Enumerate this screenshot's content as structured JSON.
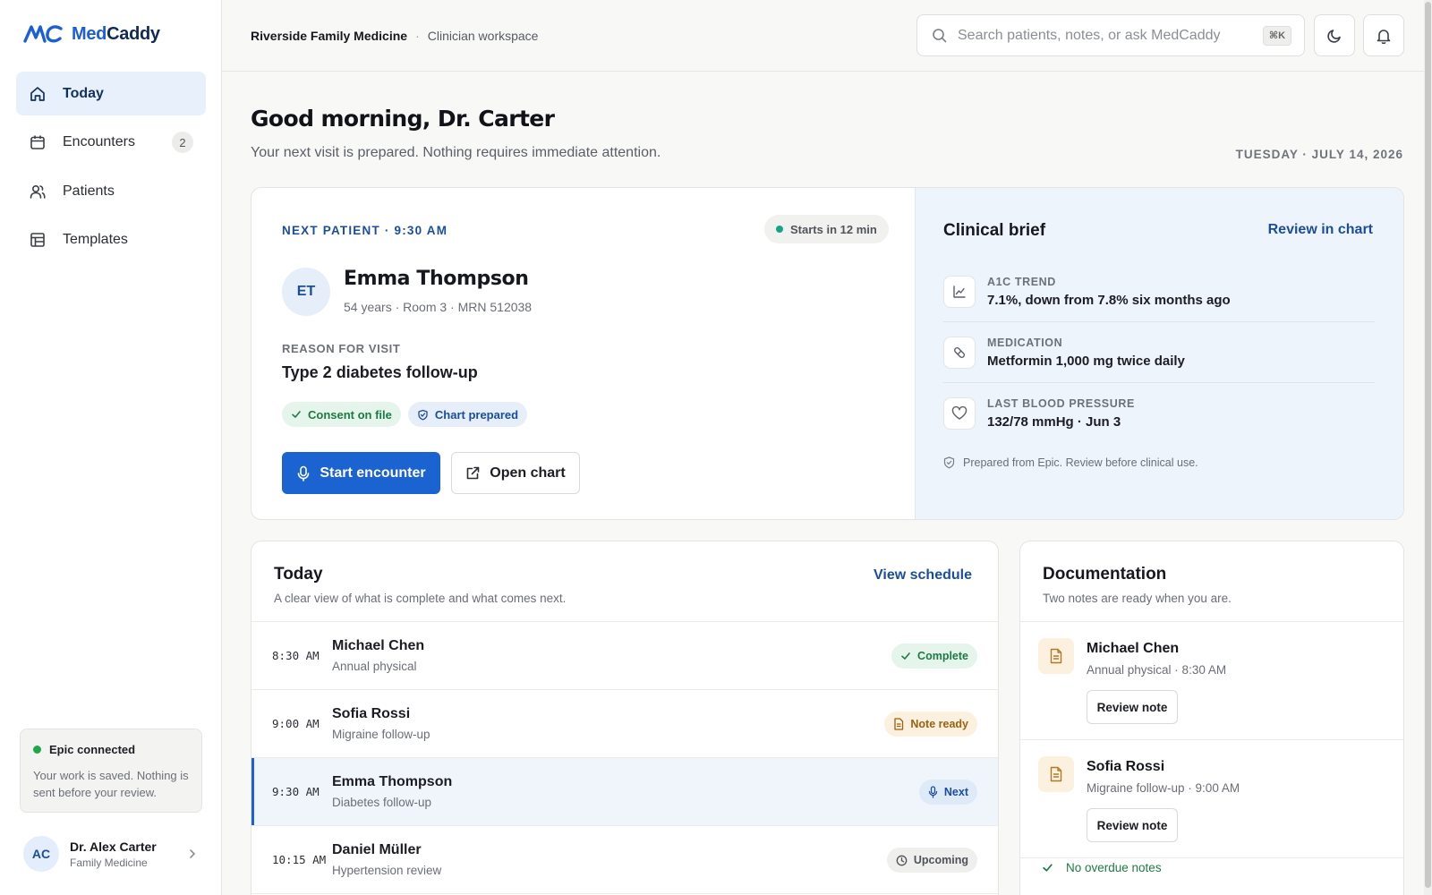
{
  "app": {
    "logo_monogram": "MC",
    "logo_part1": "Med",
    "logo_part2": "Caddy",
    "brand_color": "#1b5fd6"
  },
  "sidebar": {
    "items": [
      {
        "label": "Today",
        "icon": "home-icon",
        "active": true
      },
      {
        "label": "Encounters",
        "icon": "calendar-icon",
        "badge": "2"
      },
      {
        "label": "Patients",
        "icon": "users-icon"
      },
      {
        "label": "Templates",
        "icon": "template-icon"
      }
    ],
    "status": {
      "title": "Epic connected",
      "text": "Your work is saved. Nothing is sent before your review."
    },
    "user": {
      "initials": "AC",
      "name": "Dr. Alex Carter",
      "role": "Family Medicine"
    }
  },
  "header": {
    "clinic": "Riverside Family Medicine",
    "separator": "·",
    "workspace": "Clinician workspace",
    "search_placeholder": "Search patients, notes, or ask MedCaddy",
    "search_shortcut": "⌘K"
  },
  "main": {
    "greeting": "Good morning, Dr. Carter",
    "subline": "Your next visit is prepared. Nothing requires immediate attention.",
    "date": "TUESDAY · JULY 14, 2026"
  },
  "next_patient": {
    "label": "NEXT PATIENT · 9:30 AM",
    "starts": "Starts in 12 min",
    "initials": "ET",
    "name": "Emma Thompson",
    "meta": "54 years · Room 3 · MRN 512038",
    "reason_label": "REASON FOR VISIT",
    "reason": "Type 2 diabetes follow-up",
    "chips": [
      "Consent on file",
      "Chart prepared"
    ],
    "start_button": "Start encounter",
    "open_button": "Open chart"
  },
  "clinical_brief": {
    "title": "Clinical brief",
    "link": "Review in chart",
    "rows": [
      {
        "label": "A1C TREND",
        "value": "7.1%, down from 7.8% six months ago",
        "icon": "trend-chart-icon"
      },
      {
        "label": "MEDICATION",
        "value": "Metformin 1,000 mg twice daily",
        "icon": "pill-icon"
      },
      {
        "label": "LAST BLOOD PRESSURE",
        "value": "132/78 mmHg · Jun 3",
        "icon": "heart-icon"
      }
    ],
    "note": "Prepared from Epic. Review before clinical use."
  },
  "today": {
    "title": "Today",
    "subtitle": "A clear view of what is complete and what comes next.",
    "link": "View schedule",
    "appointments": [
      {
        "time": "8:30 AM",
        "name": "Michael Chen",
        "type": "Annual physical",
        "status": "Complete"
      },
      {
        "time": "9:00 AM",
        "name": "Sofia Rossi",
        "type": "Migraine follow-up",
        "status": "Note ready"
      },
      {
        "time": "9:30 AM",
        "name": "Emma Thompson",
        "type": "Diabetes follow-up",
        "status": "Next"
      },
      {
        "time": "10:15 AM",
        "name": "Daniel Müller",
        "type": "Hypertension review",
        "status": "Upcoming"
      }
    ]
  },
  "documentation": {
    "title": "Documentation",
    "subtitle": "Two notes are ready when you are.",
    "notes": [
      {
        "name": "Michael Chen",
        "meta": "Annual physical · 8:30 AM",
        "button": "Review note"
      },
      {
        "name": "Sofia Rossi",
        "meta": "Migraine follow-up · 9:00 AM",
        "button": "Review note"
      }
    ],
    "footer": "No overdue notes"
  }
}
